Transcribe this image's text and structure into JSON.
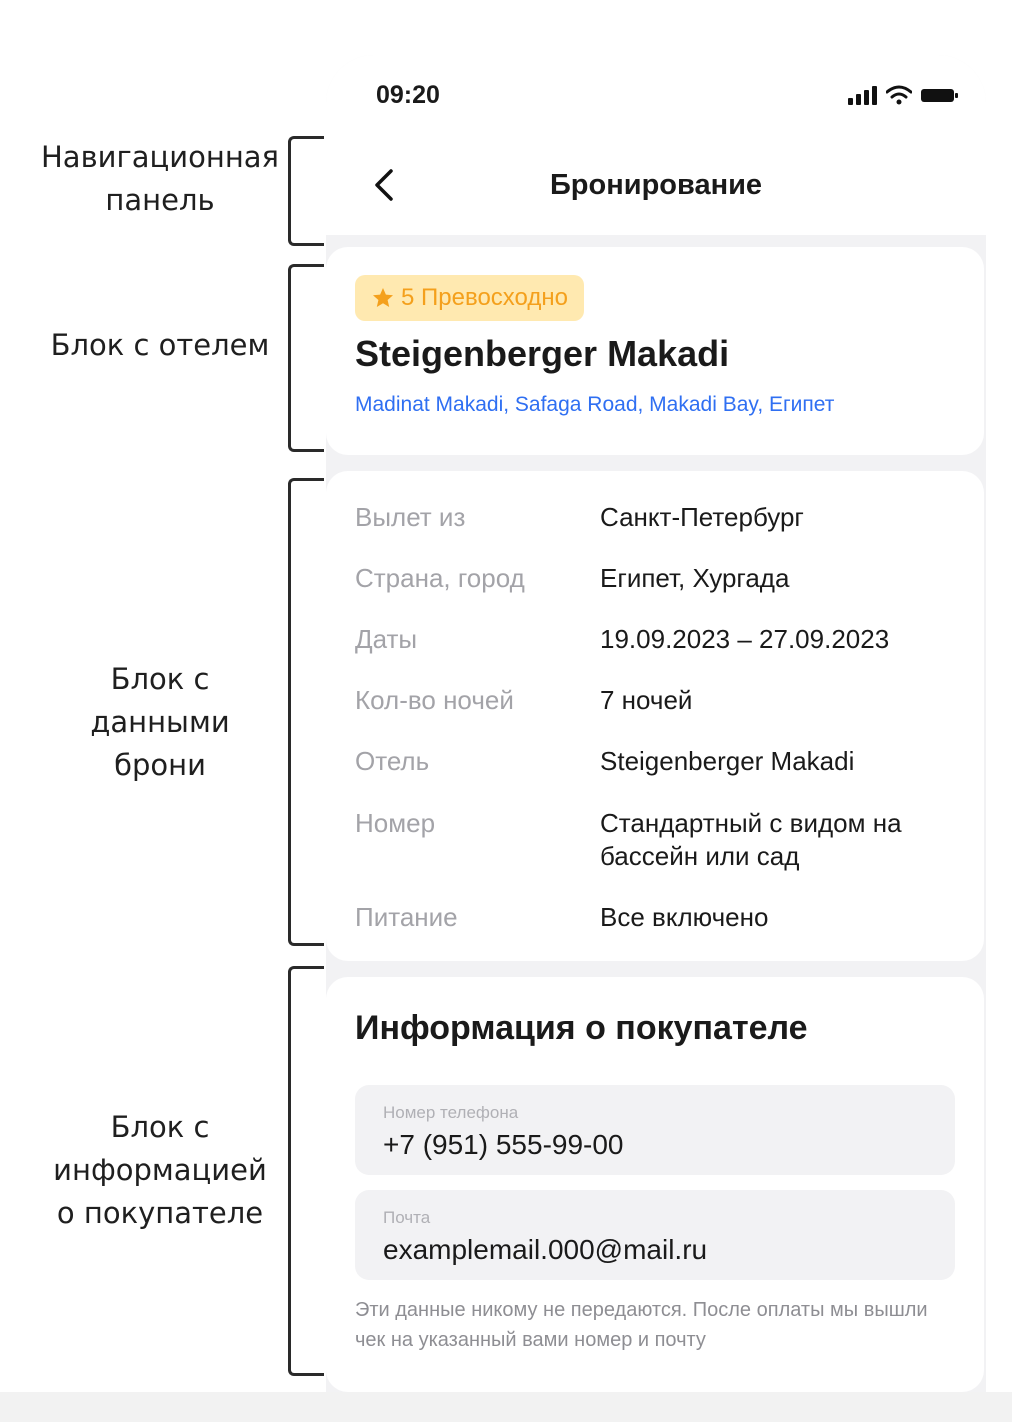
{
  "annotations": {
    "nav": "Навигационная панель",
    "hotel": "Блок с отелем",
    "booking": "Блок с данными брони",
    "buyer": "Блок с информацией о покупателе"
  },
  "status_bar": {
    "time": "09:20"
  },
  "header": {
    "title": "Бронирование"
  },
  "hotel": {
    "rating_badge": "5 Превосходно",
    "name": "Steigenberger Makadi",
    "address": "Madinat Makadi, Safaga Road, Makadi Bay, Египет"
  },
  "booking": {
    "rows": [
      {
        "label": "Вылет из",
        "value": "Санкт-Петербург"
      },
      {
        "label": "Страна, город",
        "value": "Египет, Хургада"
      },
      {
        "label": "Даты",
        "value": "19.09.2023 – 27.09.2023"
      },
      {
        "label": "Кол-во ночей",
        "value": "7 ночей"
      },
      {
        "label": "Отель",
        "value": "Steigenberger Makadi"
      },
      {
        "label": "Номер",
        "value": "Стандартный с видом на бассейн или сад"
      },
      {
        "label": "Питание",
        "value": "Все включено"
      }
    ]
  },
  "buyer": {
    "title": "Информация о покупателе",
    "phone": {
      "label": "Номер телефона",
      "value": "+7 (951) 555-99-00"
    },
    "email": {
      "label": "Почта",
      "value": "examplemail.000@mail.ru"
    },
    "note": "Эти данные никому не передаются. После оплаты мы вышли чек на указанный вами номер и почту"
  },
  "colors": {
    "accent_link": "#2f6ff2",
    "badge_bg": "#ffe9b0",
    "badge_text": "#f4a01c",
    "page_bg": "#f2f2f4"
  },
  "icons": [
    "star-icon",
    "back-chevron-icon",
    "signal-icon",
    "wifi-icon",
    "battery-icon"
  ]
}
